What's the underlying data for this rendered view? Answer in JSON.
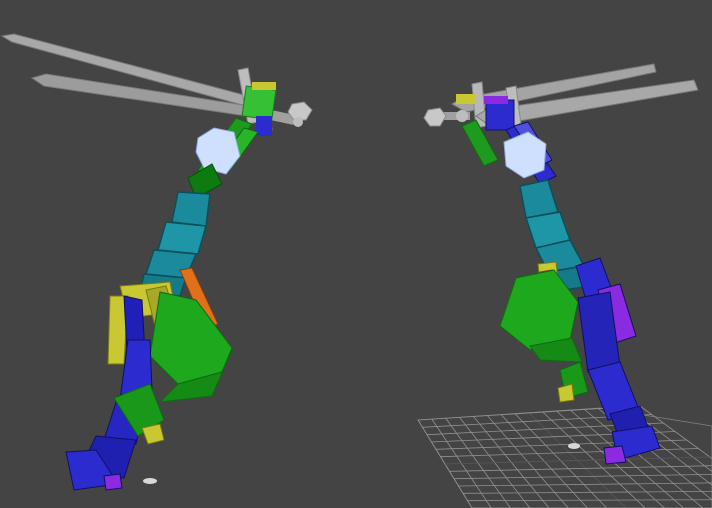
{
  "viewport": {
    "background": "#444444",
    "grid_color": "#9a9a9a",
    "colors": {
      "torso": "#1b8a9c",
      "torso_dark": "#0f5f6b",
      "limb_green": "#1ea81e",
      "limb_green_dark": "#0d7a12",
      "leg_blue": "#2b2bd0",
      "leg_blue_dark": "#1a1a8c",
      "head": "#cfe0ff",
      "sword_blade": "#9a9a9a",
      "sword_guard": "#b8b8b8",
      "accent_yellow": "#c8c832",
      "accent_orange": "#e0701a",
      "accent_purple": "#8a2be2",
      "pivot": "#d8d8d8"
    },
    "objects": [
      {
        "name": "left-biped-figure",
        "type": "biped",
        "holding": "sword"
      },
      {
        "name": "right-biped-figure",
        "type": "biped",
        "holding": "sword"
      },
      {
        "name": "ground-grid",
        "type": "grid"
      }
    ]
  }
}
